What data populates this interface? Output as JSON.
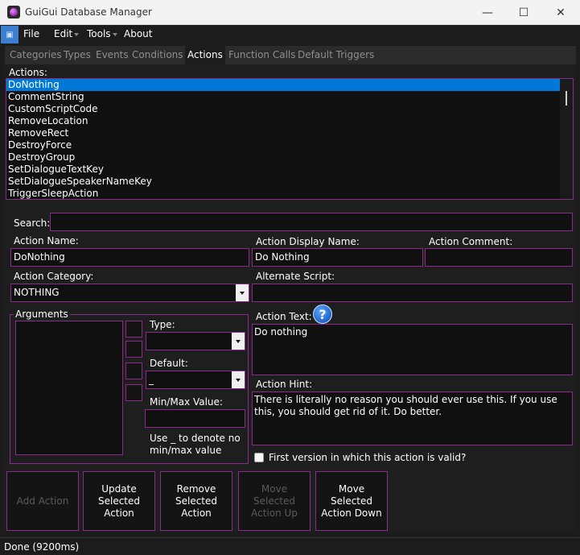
{
  "window": {
    "title": "GuiGui Database Manager",
    "minimize_glyph": "—",
    "maximize_glyph": "☐",
    "close_glyph": "✕"
  },
  "menu": {
    "items": [
      "File",
      "Edit",
      "Tools",
      "About"
    ]
  },
  "tabs": [
    {
      "label": "Categories",
      "active": false
    },
    {
      "label": "Types",
      "active": false
    },
    {
      "label": "Events",
      "active": false
    },
    {
      "label": "Conditions",
      "active": false
    },
    {
      "label": "Actions",
      "active": true
    },
    {
      "label": "Function Calls",
      "active": false
    },
    {
      "label": "Default Triggers",
      "active": false
    }
  ],
  "actions_list": {
    "label": "Actions:",
    "items": [
      "DoNothing",
      "CommentString",
      "CustomScriptCode",
      "RemoveLocation",
      "RemoveRect",
      "DestroyForce",
      "DestroyGroup",
      "SetDialogueTextKey",
      "SetDialogueSpeakerNameKey",
      "TriggerSleepAction"
    ],
    "selected": "DoNothing"
  },
  "search": {
    "label": "Search:",
    "value": ""
  },
  "form": {
    "action_name_label": "Action Name:",
    "action_name_value": "DoNothing",
    "display_name_label": "Action Display Name:",
    "display_name_value": "Do Nothing",
    "comment_label": "Action Comment:",
    "comment_value": "",
    "category_label": "Action Category:",
    "category_value": "NOTHING",
    "alt_script_label": "Alternate Script:",
    "alt_script_value": ""
  },
  "arguments": {
    "group_label": "Arguments",
    "type_label": "Type:",
    "type_value": "",
    "default_label": "Default:",
    "default_value": "_",
    "minmax_label": "Min/Max Value:",
    "minmax_value": "",
    "hint_line1": "Use _ to denote no",
    "hint_line2": "min/max value"
  },
  "action_text": {
    "label": "Action Text:",
    "value": "Do nothing",
    "help_glyph": "?"
  },
  "action_hint": {
    "label": "Action Hint:",
    "value": "There is literally no reason you should ever use this. If you use this, you should get rid of it. Do better."
  },
  "first_version": {
    "label": "First version in which this action is valid?",
    "checked": false
  },
  "buttons": [
    {
      "label": "Add Action",
      "enabled": false
    },
    {
      "label": "Update Selected Action",
      "enabled": true
    },
    {
      "label": "Remove Selected Action",
      "enabled": true
    },
    {
      "label": "Move Selected Action Up",
      "enabled": false
    },
    {
      "label": "Move Selected Action Down",
      "enabled": true
    }
  ],
  "status": {
    "text": "Done (9200ms)"
  },
  "colors": {
    "accent_border": "#8a2a8a",
    "selection": "#0078d7",
    "background": "#1c1c1c"
  }
}
